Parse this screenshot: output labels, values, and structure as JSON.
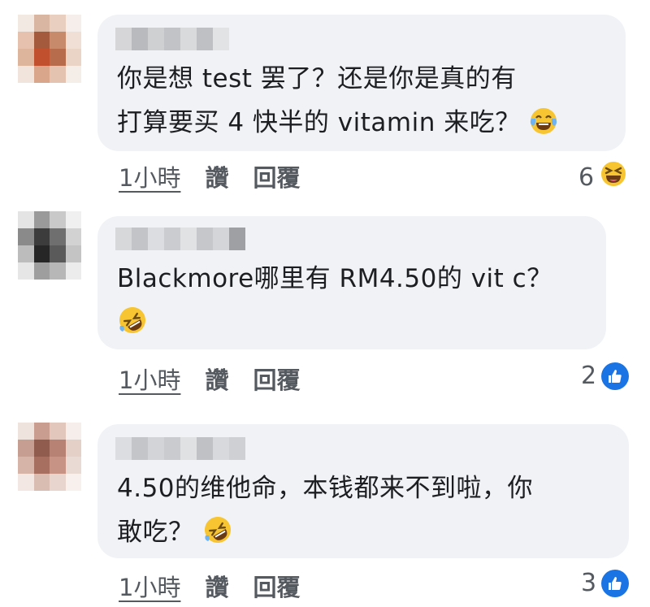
{
  "comments": [
    {
      "line1": "你是想 test 罢了？还是你是真的有",
      "line2": "打算要买 4 快半的 vitamin 来吃？",
      "inline_emoji": "tears-of-joy-emoji",
      "time": "1小時",
      "like_label": "讚",
      "reply_label": "回覆",
      "reaction_count": "6",
      "reaction_icon": "laughing-squint-emoji"
    },
    {
      "line1": "Blackmore哪里有 RM4.50的 vit c？",
      "line2": "",
      "inline_emoji": "rolling-on-floor-laughing-emoji",
      "time": "1小時",
      "like_label": "讚",
      "reply_label": "回覆",
      "reaction_count": "2",
      "reaction_icon": "like-thumb-icon"
    },
    {
      "line1": "4.50的维他命，本钱都来不到啦，你",
      "line2": "敢吃？",
      "inline_emoji": "rolling-on-floor-laughing-emoji",
      "time": "1小時",
      "like_label": "讚",
      "reply_label": "回覆",
      "reaction_count": "3",
      "reaction_icon": "like-thumb-icon"
    }
  ],
  "colors": {
    "bubble": "#f0f2f5",
    "like_blue": "#1b74e4",
    "emoji_yellow": "#f7c531"
  }
}
